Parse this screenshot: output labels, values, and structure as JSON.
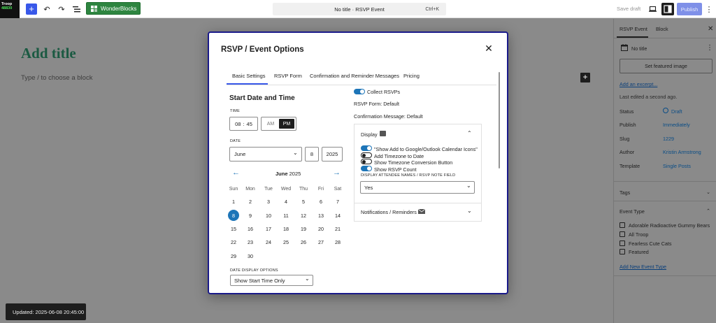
{
  "topbar": {
    "logo_line1": "Troop",
    "logo_line2": "48830",
    "inserter_icon": "plus-icon",
    "wonderblocks_label": "WonderBlocks",
    "command_title": "No title · RSVP Event",
    "command_shortcut": "Ctrl+K",
    "save_draft": "Save draft",
    "publish": "Publish"
  },
  "editor": {
    "title_placeholder": "Add title",
    "block_placeholder": "Type / to choose a block",
    "block_add_icon": "plus-icon"
  },
  "snackbar": {
    "text": "Updated: 2025-06-08 20:45:00"
  },
  "sidebar": {
    "tabs": [
      "RSVP Event",
      "Block"
    ],
    "post_title": "No title",
    "featured_image_button": "Set featured image",
    "excerpt_link": "Add an excerpt...",
    "last_edited": "Last edited a second ago.",
    "rows": [
      {
        "label": "Status",
        "value": "Draft"
      },
      {
        "label": "Publish",
        "value": "Immediately"
      },
      {
        "label": "Slug",
        "value": "1229"
      },
      {
        "label": "Author",
        "value": "Kristin Armstrong"
      },
      {
        "label": "Template",
        "value": "Single Posts"
      }
    ],
    "tags_label": "Tags",
    "event_type_label": "Event Type",
    "event_types": [
      "Adorable Radioactive Gummy Bears",
      "All Troop",
      "Fearless Cute Cats",
      "Featured"
    ],
    "add_event_type": "Add New Event Type"
  },
  "modal": {
    "title": "RSVP / Event Options",
    "tabs": [
      "Basic Settings",
      "RSVP Form",
      "Confirmation and Reminder Messages",
      "Pricing"
    ],
    "active_tab": "Basic Settings",
    "start_section": "Start Date and Time",
    "time_label": "TIME",
    "hour": "08",
    "minute": "45",
    "am": "AM",
    "pm": "PM",
    "date_label": "DATE",
    "month": "June",
    "day": "8",
    "year": "2025",
    "calendar_month": "June",
    "calendar_year": "2025",
    "weekdays": [
      "Sun",
      "Mon",
      "Tue",
      "Wed",
      "Thu",
      "Fri",
      "Sat"
    ],
    "weeks": [
      [
        "1",
        "2",
        "3",
        "4",
        "5",
        "6",
        "7"
      ],
      [
        "8",
        "9",
        "10",
        "11",
        "12",
        "13",
        "14"
      ],
      [
        "15",
        "16",
        "17",
        "18",
        "19",
        "20",
        "21"
      ],
      [
        "22",
        "23",
        "24",
        "25",
        "26",
        "27",
        "28"
      ],
      [
        "29",
        "30",
        "",
        "",
        "",
        "",
        ""
      ]
    ],
    "selected_day": "8",
    "date_display_label": "DATE DISPLAY OPTIONS",
    "date_display_value": "Show Start Time Only",
    "collect_rsvps": "Collect RSVPs",
    "rsvp_form": "RSVP Form: Default",
    "confirmation": "Confirmation Message: Default",
    "display_panel": "Display",
    "options": [
      {
        "label": "\"Show Add to Google/Outlook Calendar Icons\"",
        "on": true
      },
      {
        "label": "Add Timezone to Date",
        "on": false
      },
      {
        "label": "Show Timezone Conversion Button",
        "on": false
      },
      {
        "label": "Show RSVP Count",
        "on": true
      }
    ],
    "attendee_label": "DISPLAY ATTENDEE NAMES / RSVP NOTE FIELD",
    "attendee_value": "Yes",
    "notifications_panel": "Notifications / Reminders",
    "accent": "#1d75b8"
  }
}
